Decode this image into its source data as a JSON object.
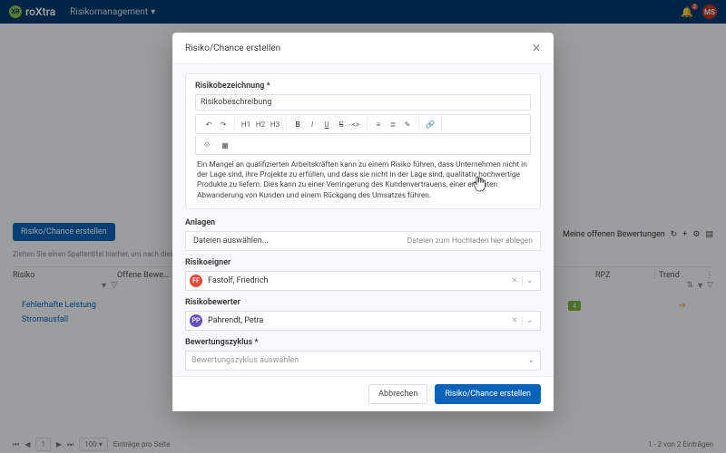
{
  "brand": {
    "name": "roXtra",
    "badge": "XR"
  },
  "nav": {
    "item1": "Risikomanagement"
  },
  "topright": {
    "bell_count": "2",
    "user_initials": "MS"
  },
  "bg": {
    "create_btn": "Risiko/Chance erstellen",
    "right_header": "Meine offenen Bewertungen",
    "group_hint": "Ziehen Sie einen Spaltentitel hierher, um nach dieser Spalt…",
    "cols": {
      "risiko": "Risiko",
      "offene": "Offene Bewe…",
      "rpz": "RPZ",
      "trend": "Trend"
    },
    "rows": {
      "r1": "Fehlerhafte Leistung",
      "r2": "Stromausfall"
    },
    "badge": "4",
    "pager": {
      "page": "1",
      "size": "100",
      "label": "Einträge pro Seite",
      "info": "1 - 2 von 2 Einträgen"
    }
  },
  "modal": {
    "title": "Risiko/Chance erstellen",
    "sec_bezeichnung": "Risikobezeichnung *",
    "desc_label": "Risikobeschreibung",
    "body_text": "Ein Mangel an qualifizierten Arbeitskräften kann zu einem Risiko führen, dass Unternehmen nicht in der Lage sind, ihre Projekte zu erfüllen, und dass sie nicht in der Lage sind, qualitativ hochwertige Produkte zu liefern. Dies kann zu einer Verringerung des Kundenvertrauens, einer erhöhten Abwanderung von Kunden und einem Rückgang des Umsatzes führen.",
    "sec_anlagen": "Anlagen",
    "file_btn": "Dateien auswählen...",
    "file_drop": "Dateien zum Hochladen hier ablegen",
    "sec_owner": "Risikoeigner",
    "owner": {
      "initials": "FF",
      "name": "Fastolf, Friedrich"
    },
    "sec_assessor": "Risikobewerter",
    "assessor": {
      "initials": "PP",
      "name": "Pahrendt, Petra"
    },
    "sec_cycle": "Bewertungszyklus *",
    "cycle_ph": "Bewertungszyklus auswählen",
    "btn_cancel": "Abbrechen",
    "btn_submit": "Risiko/Chance erstellen"
  },
  "colors": {
    "owner": "#e74c3c",
    "assessor": "#6a4fbf"
  }
}
